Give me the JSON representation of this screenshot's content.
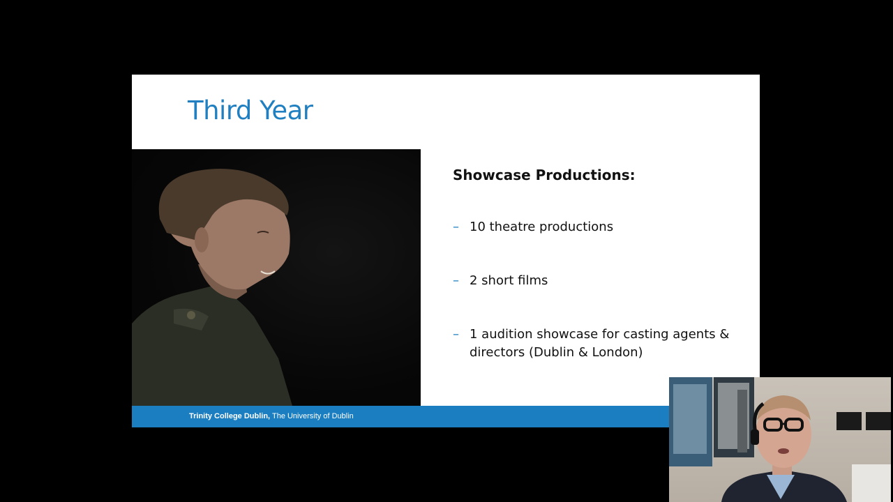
{
  "slide": {
    "title": "Third Year",
    "heading": "Showcase Productions:",
    "bullets": [
      "10 theatre productions",
      "2 short films",
      "1 audition showcase for casting agents & directors (Dublin & London)"
    ],
    "bullet_marker": "–",
    "footer": {
      "institution": "Trinity College Dublin,",
      "subtitle": " The University of Dublin"
    }
  },
  "colors": {
    "title": "#1f7fc0",
    "footer_bar": "#1a7ec0",
    "background": "#000000"
  },
  "webcam": {
    "person": "presenter-video-feed"
  }
}
